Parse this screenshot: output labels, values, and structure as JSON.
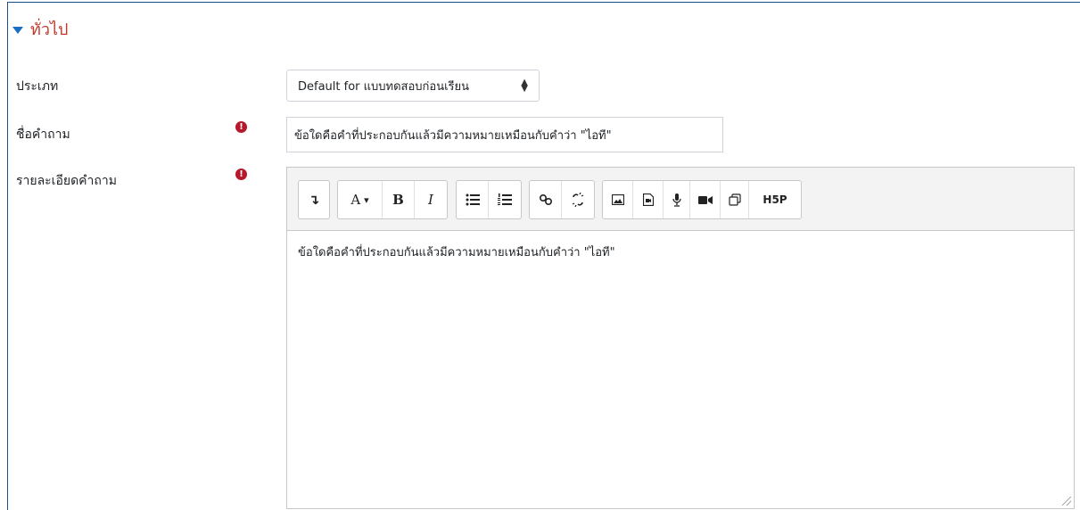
{
  "section": {
    "title": "ทั่วไป"
  },
  "fields": {
    "type_label": "ประเภท",
    "type_value": "Default for แบบทดสอบก่อนเรียน",
    "name_label": "ชื่อคำถาม",
    "name_value": "ข้อใดคือคำที่ประกอบกันแล้วมีความหมายเหมือนกับคำว่า \"ไอที\"",
    "details_label": "รายละเอียดคำถาม",
    "required_mark": "!"
  },
  "editor": {
    "content": "ข้อใดคือคำที่ประกอบกันแล้วมีความหมายเหมือนกับคำว่า \"ไอที\"",
    "toolbar": {
      "collapse": "↴",
      "font": "A",
      "font_caret": "▾",
      "bold": "B",
      "italic": "I",
      "h5p": "H5P"
    }
  },
  "colors": {
    "accent_red": "#c0392b",
    "caret_blue": "#1a6fc4",
    "required": "#b5192b"
  }
}
